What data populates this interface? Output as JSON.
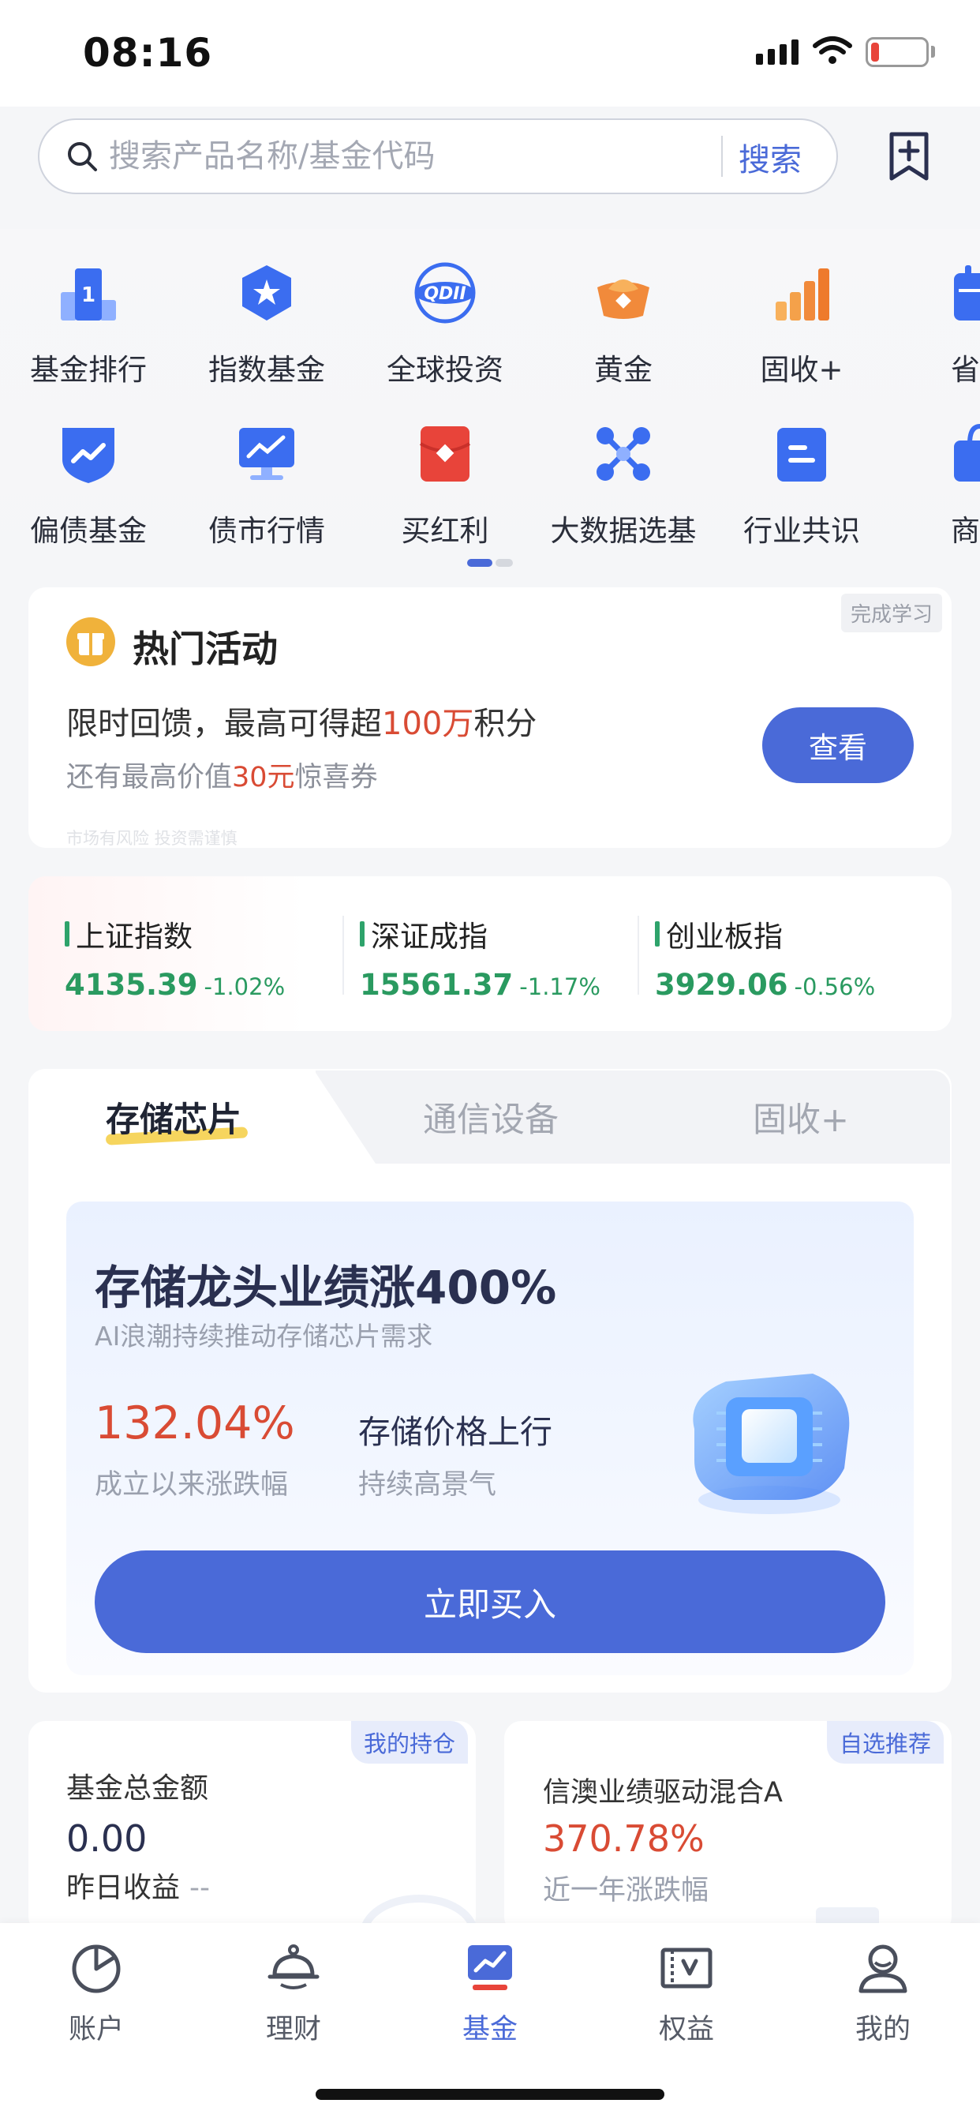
{
  "status_bar": {
    "time": "08:16",
    "battery_level": 0.15
  },
  "search": {
    "placeholder": "搜索产品名称/基金代码",
    "button_label": "搜索"
  },
  "quick_grid": {
    "row1": [
      {
        "label": "基金排行",
        "icon": "ranking-icon"
      },
      {
        "label": "指数基金",
        "icon": "index-fund-icon"
      },
      {
        "label": "全球投资",
        "icon": "qdii-icon"
      },
      {
        "label": "黄金",
        "icon": "gold-ingot-icon"
      },
      {
        "label": "固收+",
        "icon": "bar-chart-icon"
      },
      {
        "label": "省心",
        "icon": "calendar-icon"
      }
    ],
    "row2": [
      {
        "label": "偏债基金",
        "icon": "bond-shield-icon"
      },
      {
        "label": "债市行情",
        "icon": "monitor-trend-icon"
      },
      {
        "label": "买红利",
        "icon": "red-envelope-icon"
      },
      {
        "label": "大数据选基",
        "icon": "network-nodes-icon"
      },
      {
        "label": "行业共识",
        "icon": "document-icon"
      },
      {
        "label": "商品",
        "icon": "shopping-bag-icon"
      }
    ]
  },
  "promo": {
    "tag": "完成学习",
    "title": "热门活动",
    "line1_prefix": "限时回馈，最高可得超",
    "line1_highlight": "100万",
    "line1_suffix": "积分",
    "line2_prefix": "还有最高价值",
    "line2_highlight": "30元",
    "line2_suffix": "惊喜券",
    "button_label": "查看",
    "risk_note": "市场有风险 投资需谨慎"
  },
  "indices": [
    {
      "name": "上证指数",
      "value": "4135.39",
      "change": "-1.02%"
    },
    {
      "name": "深证成指",
      "value": "15561.37",
      "change": "-1.17%"
    },
    {
      "name": "创业板指",
      "value": "3929.06",
      "change": "-0.56%"
    }
  ],
  "theme": {
    "tabs": [
      "存储芯片",
      "通信设备",
      "固收+"
    ],
    "title": "存储龙头业绩涨400%",
    "subtitle": "AI浪潮持续推动存储芯片需求",
    "return_pct": "132.04%",
    "return_label": "成立以来涨跌幅",
    "feature": "存储价格上行",
    "feature_sub": "持续高景气",
    "buy_label": "立即买入"
  },
  "holdings": {
    "tag": "我的持仓",
    "total_label": "基金总金额",
    "total_amount": "0.00",
    "yesterday_label": "昨日收益",
    "yesterday_value": "--"
  },
  "recommend": {
    "tag": "自选推荐",
    "fund_name": "信澳业绩驱动混合A",
    "return_pct": "370.78%",
    "return_label": "近一年涨跌幅"
  },
  "tab_bar": [
    {
      "label": "账户",
      "icon": "pie-chart-icon"
    },
    {
      "label": "理财",
      "icon": "piggy-bank-icon"
    },
    {
      "label": "基金",
      "icon": "fund-chart-icon",
      "active": true
    },
    {
      "label": "权益",
      "icon": "voucher-icon"
    },
    {
      "label": "我的",
      "icon": "user-icon"
    }
  ],
  "colors": {
    "accent": "#4a6ad8",
    "down_green": "#2a9a60",
    "up_red": "#d94b34",
    "highlight_yellow": "#f6d55e"
  }
}
